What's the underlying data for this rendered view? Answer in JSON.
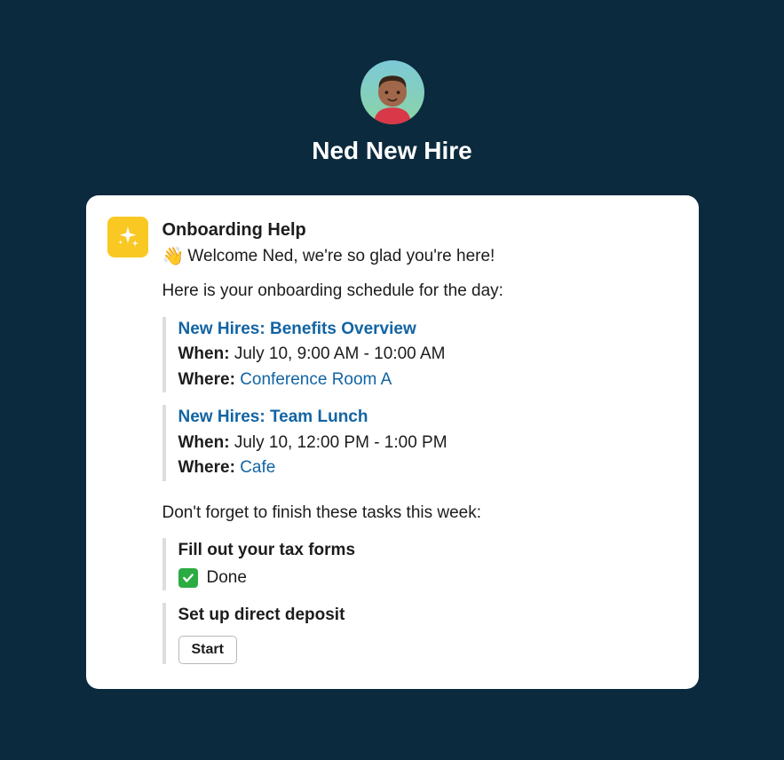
{
  "user": {
    "name": "Ned New Hire"
  },
  "message": {
    "app_name": "Onboarding Help",
    "wave_emoji": "👋",
    "welcome_text": "Welcome Ned, we're so glad you're here!",
    "schedule_intro": "Here is your onboarding schedule for the day:",
    "events": [
      {
        "title": "New Hires: Benefits Overview",
        "when_label": "When:",
        "when_value": "July 10, 9:00 AM - 10:00 AM",
        "where_label": "Where:",
        "where_value": "Conference Room A"
      },
      {
        "title": "New Hires: Team Lunch",
        "when_label": "When:",
        "when_value": "July 10, 12:00 PM - 1:00 PM",
        "where_label": "Where:",
        "where_value": "Cafe"
      }
    ],
    "tasks_intro": "Don't forget to finish these tasks this week:",
    "tasks": [
      {
        "title": "Fill out your tax forms",
        "status_text": "Done"
      },
      {
        "title": "Set up direct deposit",
        "button_label": "Start"
      }
    ]
  }
}
